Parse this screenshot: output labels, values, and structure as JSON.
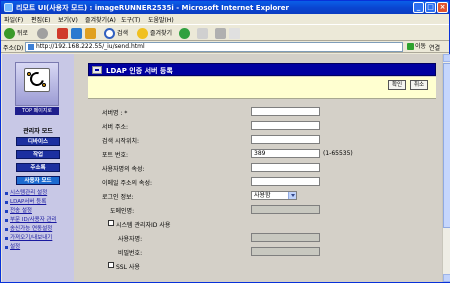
{
  "window": {
    "title": "리모트 UI(사용자 모드) : imageRUNNER2535i - Microsoft Internet Explorer",
    "controls": [
      "minimize-icon",
      "maximize-icon",
      "close-icon"
    ]
  },
  "menu": [
    "파일(F)",
    "편집(E)",
    "보기(V)",
    "즐겨찾기(A)",
    "도구(T)",
    "도움말(H)"
  ],
  "toolbar": {
    "back_label": "뒤로",
    "search_label": "검색",
    "favorites_label": "즐겨찾기"
  },
  "address": {
    "label": "주소(D)",
    "url": "http://192.168.222.55/_iu/send.html",
    "go_label": "이동",
    "links_label": "연결"
  },
  "sidebar": {
    "logo_label": "TOP 페이지로",
    "title": "관리자 모드",
    "nav": [
      "디바이스",
      "작업",
      "주소록",
      "사용자 모드"
    ],
    "active_nav": "사용자 모드",
    "links": [
      "시스템관리 설정",
      "LDAP서버 등록",
      "전송 설정",
      "부문 ID/사용자 관리",
      "송신가능 연동설정",
      "가져오기/내보내기",
      "설정"
    ]
  },
  "panel": {
    "title": "LDAP 인증 서버 등록",
    "ok_label": "확인",
    "cancel_label": "취소"
  },
  "form": {
    "server_name": {
      "label": "서버명 : *",
      "value": ""
    },
    "server_address": {
      "label": "서버 주소:",
      "value": ""
    },
    "search_start": {
      "label": "검색 시작위치:",
      "value": ""
    },
    "port": {
      "label": "포트 번호:",
      "value": "389",
      "hint": "(1-65535)"
    },
    "username_attr": {
      "label": "사용자명의 속성:",
      "value": ""
    },
    "email_attr": {
      "label": "이메일 주소의 속성:",
      "value": ""
    },
    "login_info": {
      "label": "로그인 정보:",
      "selected": "사용함"
    },
    "domain_name": {
      "label": "도메인명:",
      "value": ""
    },
    "use_admin": {
      "label": "시스템 관리자ID 사용"
    },
    "user_name": {
      "label": "사용자명:",
      "value": ""
    },
    "password": {
      "label": "비밀번호:",
      "value": ""
    },
    "use_ssl": {
      "label": "SSL 사용"
    }
  },
  "colors": {
    "panel_header": "#0000a0",
    "nav_button": "#1c2fa0",
    "sidebar_bg": "#c8c8e6",
    "yellow_bar": "#ffffd0"
  }
}
